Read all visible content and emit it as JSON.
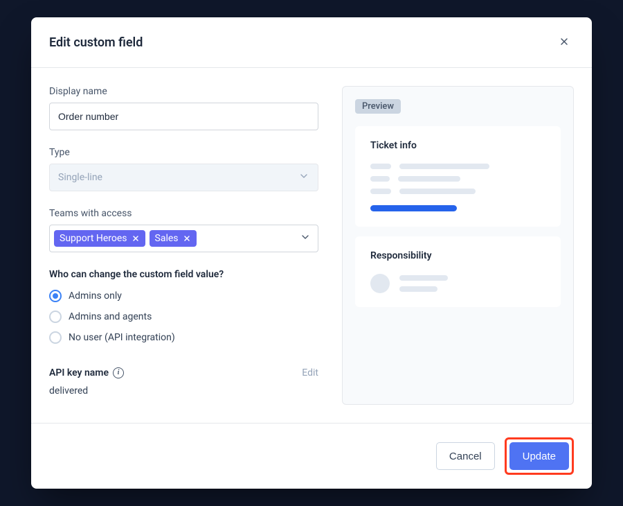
{
  "header": {
    "title": "Edit custom field"
  },
  "form": {
    "display_name_label": "Display name",
    "display_name_value": "Order number",
    "type_label": "Type",
    "type_value": "Single-line",
    "teams_label": "Teams with access",
    "teams": [
      "Support Heroes",
      "Sales"
    ],
    "permission_label": "Who can change the custom field value?",
    "permissions": {
      "opt1": "Admins only",
      "opt2": "Admins and agents",
      "opt3": "No user (API integration)"
    },
    "permission_selected": "opt1",
    "api_key_label": "API key name",
    "api_key_edit": "Edit",
    "api_key_value": "delivered"
  },
  "preview": {
    "badge": "Preview",
    "card1_title": "Ticket info",
    "card2_title": "Responsibility"
  },
  "footer": {
    "cancel": "Cancel",
    "update": "Update"
  }
}
